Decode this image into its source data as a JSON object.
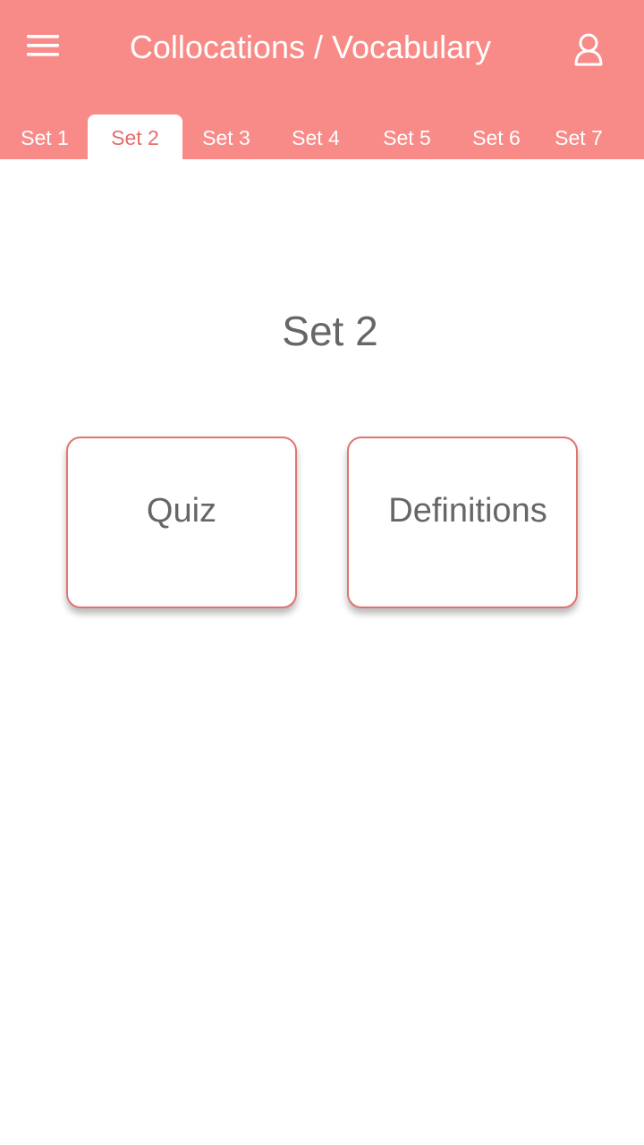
{
  "app_bar": {
    "title": "Collocations / Vocabulary",
    "background_color": "#f88b88",
    "menu_icon": "hamburger-menu-icon",
    "user_icon": "user-profile-icon"
  },
  "tabs": [
    {
      "label": "Set 1",
      "active": false
    },
    {
      "label": "Set 2",
      "active": true
    },
    {
      "label": "Set 3",
      "active": false
    },
    {
      "label": "Set 4",
      "active": false
    },
    {
      "label": "Set 5",
      "active": false
    },
    {
      "label": "Set 6",
      "active": false
    },
    {
      "label": "Set 7",
      "active": false
    }
  ],
  "main": {
    "set_title": "Set 2",
    "quiz_label": "Quiz",
    "definitions_label": "Definitions"
  },
  "colors": {
    "accent": "#f88b88",
    "active_tab_text": "#e36e6b",
    "card_border": "#e07470",
    "body_text": "#666666"
  }
}
